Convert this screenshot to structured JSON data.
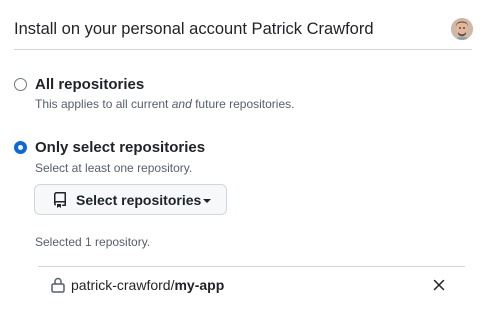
{
  "header": {
    "title": "Install on your personal account Patrick Crawford"
  },
  "options": {
    "all": {
      "label": "All repositories",
      "note_before": "This applies to all current ",
      "note_em": "and",
      "note_after": " future repositories.",
      "selected": false
    },
    "select": {
      "label": "Only select repositories",
      "note": "Select at least one repository.",
      "selected": true
    }
  },
  "select_button": {
    "label": "Select repositories",
    "icon": "repo-icon"
  },
  "selection": {
    "summary": "Selected 1 repository.",
    "repos": [
      {
        "owner": "patrick-crawford/",
        "name": "my-app",
        "icon": "lock-icon"
      }
    ]
  },
  "colors": {
    "accent": "#0969da",
    "muted_text": "#57606a",
    "border": "#d0d7de"
  }
}
